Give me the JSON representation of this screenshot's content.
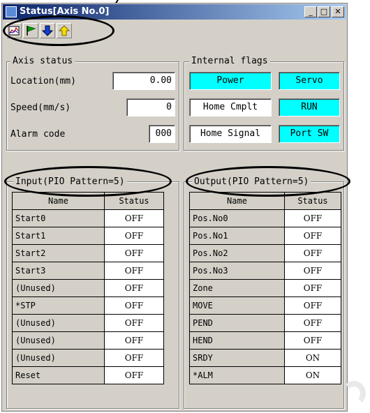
{
  "window": {
    "title": "Status[Axis No.0]",
    "minimize": "_",
    "maximize": "□",
    "close": "✕"
  },
  "toolbar": [
    {
      "icon": "graph-icon"
    },
    {
      "icon": "flag-icon"
    },
    {
      "icon": "arrow-down-icon"
    },
    {
      "icon": "arrow-up-icon"
    }
  ],
  "axis_status": {
    "label": "Axis status",
    "location_label": "Location(mm)",
    "location_value": "0.00",
    "speed_label": "Speed(mm/s)",
    "speed_value": "0",
    "alarm_label": "Alarm code",
    "alarm_value": "000"
  },
  "internal_flags": {
    "label": "Internal flags",
    "flags": [
      {
        "label": "Power",
        "on": true
      },
      {
        "label": "Servo",
        "on": true
      },
      {
        "label": "Home Cmplt",
        "on": false
      },
      {
        "label": "RUN",
        "on": true
      },
      {
        "label": "Home Signal",
        "on": false
      },
      {
        "label": "Port SW",
        "on": true
      }
    ]
  },
  "input": {
    "label": "Input(PIO Pattern=5)",
    "headers": [
      "Name",
      "Status"
    ],
    "rows": [
      [
        "Start0",
        "OFF"
      ],
      [
        "Start1",
        "OFF"
      ],
      [
        "Start2",
        "OFF"
      ],
      [
        "Start3",
        "OFF"
      ],
      [
        "(Unused)",
        "OFF"
      ],
      [
        "*STP",
        "OFF"
      ],
      [
        "(Unused)",
        "OFF"
      ],
      [
        "(Unused)",
        "OFF"
      ],
      [
        "(Unused)",
        "OFF"
      ],
      [
        "Reset",
        "OFF"
      ]
    ]
  },
  "output": {
    "label": "Output(PIO Pattern=5)",
    "headers": [
      "Name",
      "Status"
    ],
    "rows": [
      [
        "Pos.No0",
        "OFF"
      ],
      [
        "Pos.No1",
        "OFF"
      ],
      [
        "Pos.No2",
        "OFF"
      ],
      [
        "Pos.No3",
        "OFF"
      ],
      [
        "Zone",
        "OFF"
      ],
      [
        "MOVE",
        "OFF"
      ],
      [
        "PEND",
        "OFF"
      ],
      [
        "HEND",
        "OFF"
      ],
      [
        "SRDY",
        "ON"
      ],
      [
        "*ALM",
        "ON"
      ]
    ]
  }
}
